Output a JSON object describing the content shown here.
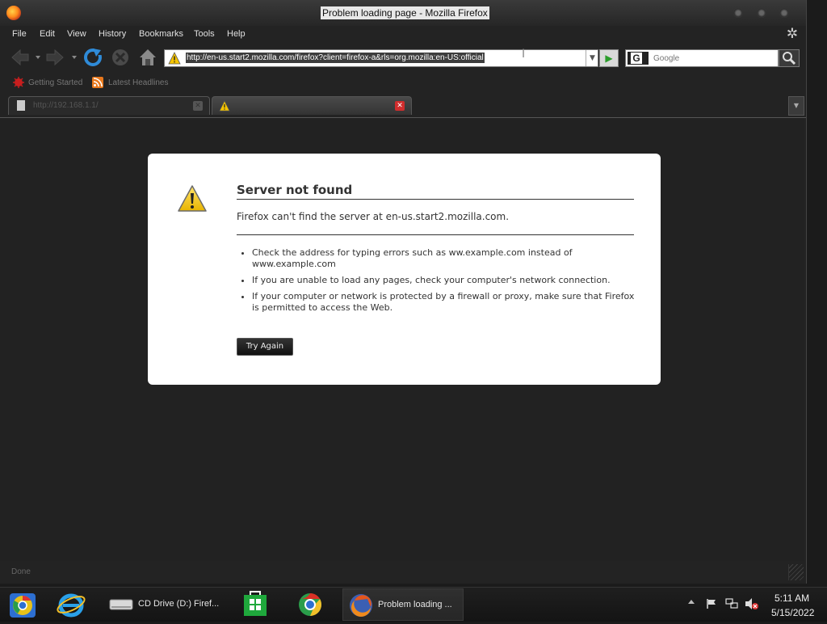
{
  "window": {
    "title": "Problem loading page - Mozilla Firefox"
  },
  "menu": {
    "items": [
      "File",
      "Edit",
      "View",
      "History",
      "Bookmarks",
      "Tools",
      "Help"
    ]
  },
  "navbar": {
    "url": "http://en-us.start2.mozilla.com/firefox?client=firefox-a&rls=org.mozilla:en-US:official",
    "search_placeholder": "Google"
  },
  "bookmarks": {
    "items": [
      "Getting Started",
      "Latest Headlines"
    ]
  },
  "tabs": [
    {
      "label": "http://192.168.1.1/"
    },
    {
      "label": ""
    }
  ],
  "error": {
    "title": "Server not found",
    "description": "Firefox can't find the server at en-us.start2.mozilla.com.",
    "tips": [
      "Check the address for typing errors such as ww.example.com instead of www.example.com",
      "If you are unable to load any pages, check your computer's network connection.",
      "If your computer or network is protected by a firewall or proxy, make sure that Firefox is permitted to access the Web."
    ],
    "button_label": "Try Again"
  },
  "statusbar": {
    "text": "Done"
  },
  "taskbar": {
    "items": [
      {
        "icon": "chrome-canary-icon",
        "label": ""
      },
      {
        "icon": "internet-explorer-icon",
        "label": ""
      },
      {
        "icon": "cd-drive-icon",
        "label": "CD Drive (D:) Firef..."
      },
      {
        "icon": "store-icon",
        "label": ""
      },
      {
        "icon": "chrome-icon",
        "label": ""
      },
      {
        "icon": "firefox-icon",
        "label": "Problem loading ..."
      }
    ],
    "clock_time": "5:11 AM",
    "clock_date": "5/15/2022"
  },
  "colors": {
    "chrome_bg": "#232323",
    "error_box_bg": "#ffffff",
    "go_arrow": "#2a9d2a",
    "tab_close_red": "#d12d2d",
    "warning_yellow": "#f5c400"
  }
}
